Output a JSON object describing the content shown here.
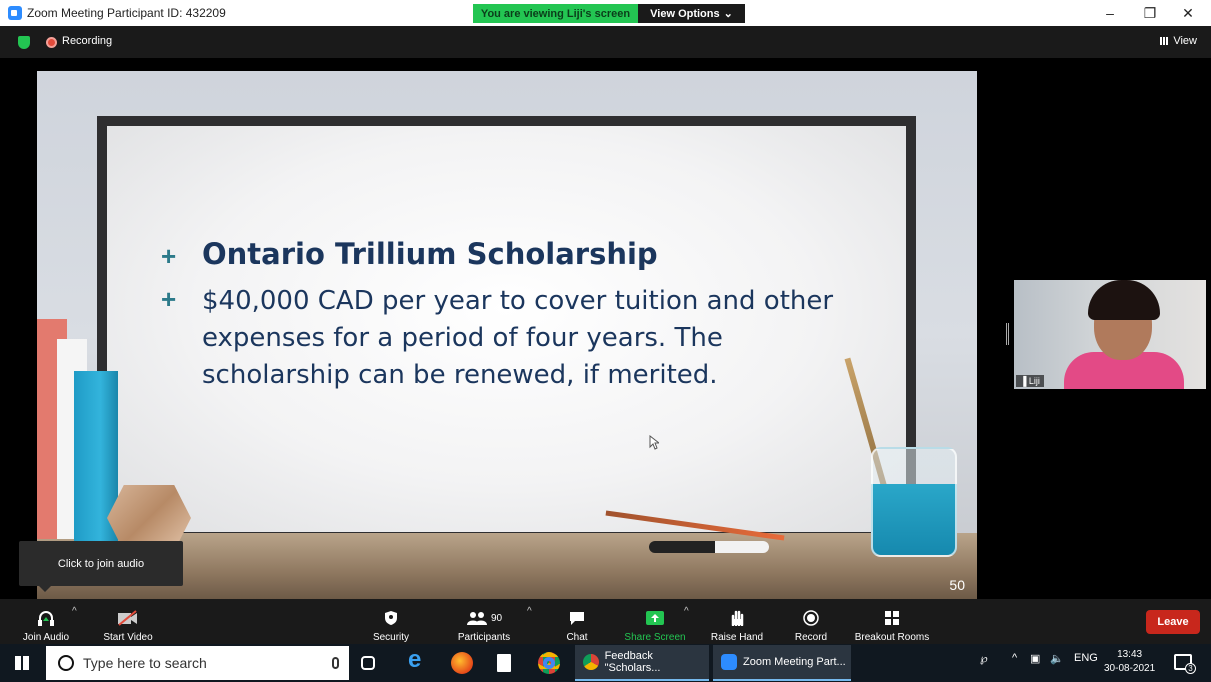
{
  "window": {
    "title": "Zoom Meeting Participant ID: 432209",
    "viewing_banner": "You are viewing Liji's screen",
    "view_options": "View Options",
    "minimize": "–",
    "restore": "❐",
    "close": "✕"
  },
  "topbar": {
    "recording": "Recording",
    "view": "View"
  },
  "slide": {
    "title": "Ontario Trillium Scholarship",
    "body": " $40,000 CAD per year to cover tuition and other expenses for a period of four years. The scholarship can be renewed, if merited.",
    "bullet": "+",
    "page_number": "50"
  },
  "participant": {
    "name": "Liji"
  },
  "tooltip": "Click to join audio",
  "toolbar": {
    "join_audio": "Join Audio",
    "start_video": "Start Video",
    "security": "Security",
    "participants": "Participants",
    "participant_count": "90",
    "chat": "Chat",
    "share_screen": "Share Screen",
    "raise_hand": "Raise Hand",
    "record": "Record",
    "breakout_rooms": "Breakout Rooms",
    "leave": "Leave"
  },
  "taskbar": {
    "search_placeholder": "Type here to search",
    "task_feedback": "Feedback \"Scholars...",
    "task_zoom": "Zoom Meeting Part...",
    "language": "ENG",
    "time": "13:43",
    "date": "30-08-2021",
    "notification_count": "3"
  },
  "colors": {
    "zoom_blue": "#2d8cff",
    "zoom_green": "#23c552",
    "leave_red": "#c8271c",
    "slide_text": "#1b365d",
    "bullet_teal": "#2c7a8a"
  }
}
